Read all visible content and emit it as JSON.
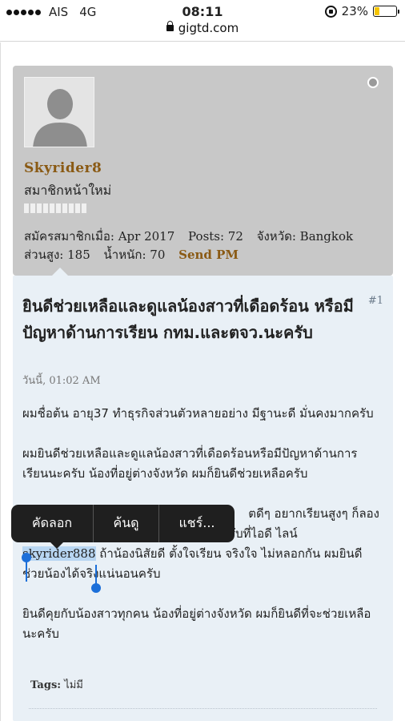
{
  "status_bar": {
    "carrier": "AIS",
    "network": "4G",
    "time": "08:11",
    "battery": "23%"
  },
  "url_bar": {
    "domain": "gigtd.com"
  },
  "user": {
    "username": "Skyrider8",
    "user_title": "สมาชิกหน้าใหม่",
    "joined": "สมัครสมาชิกเมื่อ: Apr 2017",
    "posts": "Posts: 72",
    "province": "จังหวัด: Bangkok",
    "height": "ส่วนสูง: 185",
    "weight": "น้ำหนัก: 70",
    "send_pm": "Send PM"
  },
  "post": {
    "number": "#1",
    "title": "ยินดีช่วยเหลือและดูแลน้องสาวที่เดือดร้อน หรือมีปัญหาด้านการเรียน กทม.และตจว.นะครับ",
    "date": "วันนี้, 01:02 AM",
    "para1": "ผมชื่อต้น อายุ37 ทำธุรกิจส่วนตัวหลายอย่าง มีฐานะดี มั่นคงมากครับ",
    "para2": "ผมยินดีช่วยเหลือและดูแลน้องสาวที่เดือดร้อนหรือมีปัญหาด้านการเรียนนะครับ น้องที่อยู่ต่างจังหวัด ผมก็ยินดีช่วยเหลือครับ",
    "para3_line1": "ตดีๆ อยากเรียนสูงๆ ก็ลอง",
    "para3_line2": "ทอดเข้ามาคุยรายละเอียดกันก่อนได้นะครับที่ไอดี ไลน์",
    "para3_highlight": "skyrider888",
    "para3_after": " ถ้าน้องนิสัยดี ตั้งใจเรียน จริงใจ ไม่หลอกกัน ผมยินดีช่วยน้องได้จริงแน่นอนครับ",
    "para4": "ยินดีคุยกับน้องสาวทุกคน น้องที่อยู่ต่างจังหวัด ผมก็ยินดีที่จะช่วยเหลือนะครับ",
    "tags_label": "Tags:",
    "tags_value": "ไม่มี"
  },
  "callout_menu": {
    "copy": "คัดลอก",
    "lookup": "ค้นดู",
    "share": "แชร์..."
  },
  "colors": {
    "username": "#8a5a14",
    "selection": "#b8d6f2",
    "handles": "#1c6fd9",
    "post_bg": "#e9f0f6",
    "user_card_bg": "#c8c8c8"
  }
}
